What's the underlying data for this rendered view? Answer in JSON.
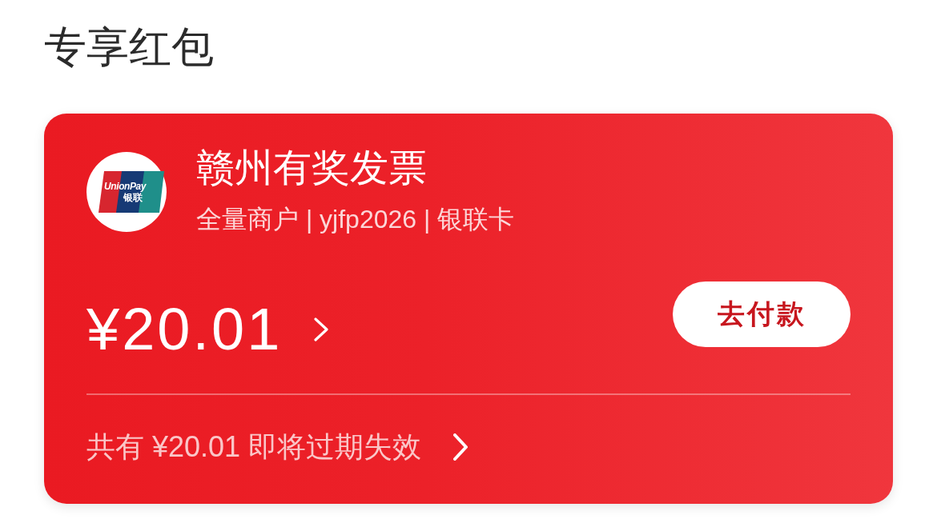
{
  "page": {
    "title": "专享红包"
  },
  "coupon": {
    "logo": {
      "text": "UnionPay",
      "subtext": "银联"
    },
    "name": "赣州有奖发票",
    "details": "全量商户 | yjfp2026 | 银联卡",
    "amount": "¥20.01",
    "pay_button": "去付款",
    "expiry_notice": "共有 ¥20.01 即将过期失效"
  }
}
